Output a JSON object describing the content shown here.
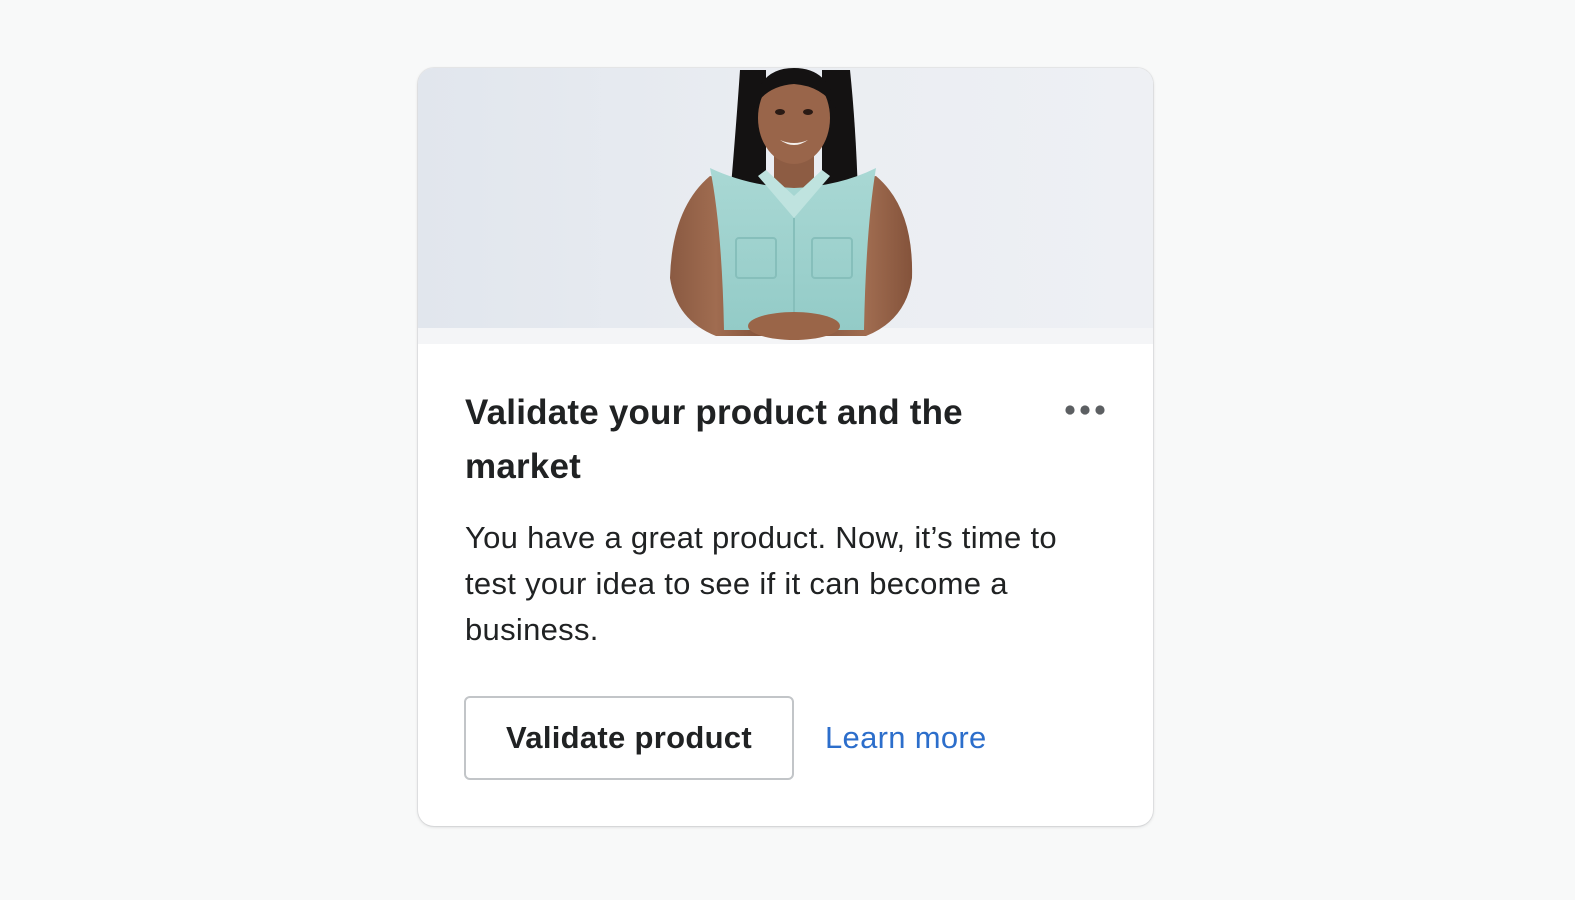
{
  "card": {
    "image_alt": "Woman in a light blue sleeveless shirt smiling at a desk",
    "title": "Validate your product and the market",
    "more_actions_icon": "horizontal-dots-icon",
    "description": "You have a great product. Now, it’s time to test your idea to see if it can become a business.",
    "primary_action": "Validate product",
    "secondary_action": "Learn more"
  },
  "colors": {
    "page_background": "#f8f9f9",
    "card_background": "#ffffff",
    "text": "#202223",
    "link": "#2c6ecb",
    "button_border": "#c2c5c8"
  }
}
